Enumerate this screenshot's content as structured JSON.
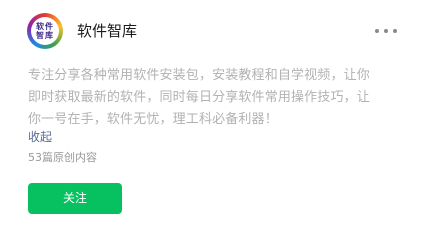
{
  "account": {
    "avatar_text_line1": "软件",
    "avatar_text_line2": "智库",
    "name": "软件智库",
    "more_icon": "more-horizontal-icon"
  },
  "description": {
    "lines": [
      "专注分享各种常用软件安装包，安装教程和自学视频，让你",
      "即时获取最新的软件，同时每日分享软件常用操作技巧，让",
      "你一号在手，软件无忧，理工科必备利器！"
    ]
  },
  "collapse_label": "收起",
  "original_count_text": "53篇原创内容",
  "follow_label": "关注",
  "colors": {
    "follow_button": "#07c160",
    "link": "#576b95",
    "description_text": "#b2b2b2",
    "meta_text": "#999999"
  }
}
